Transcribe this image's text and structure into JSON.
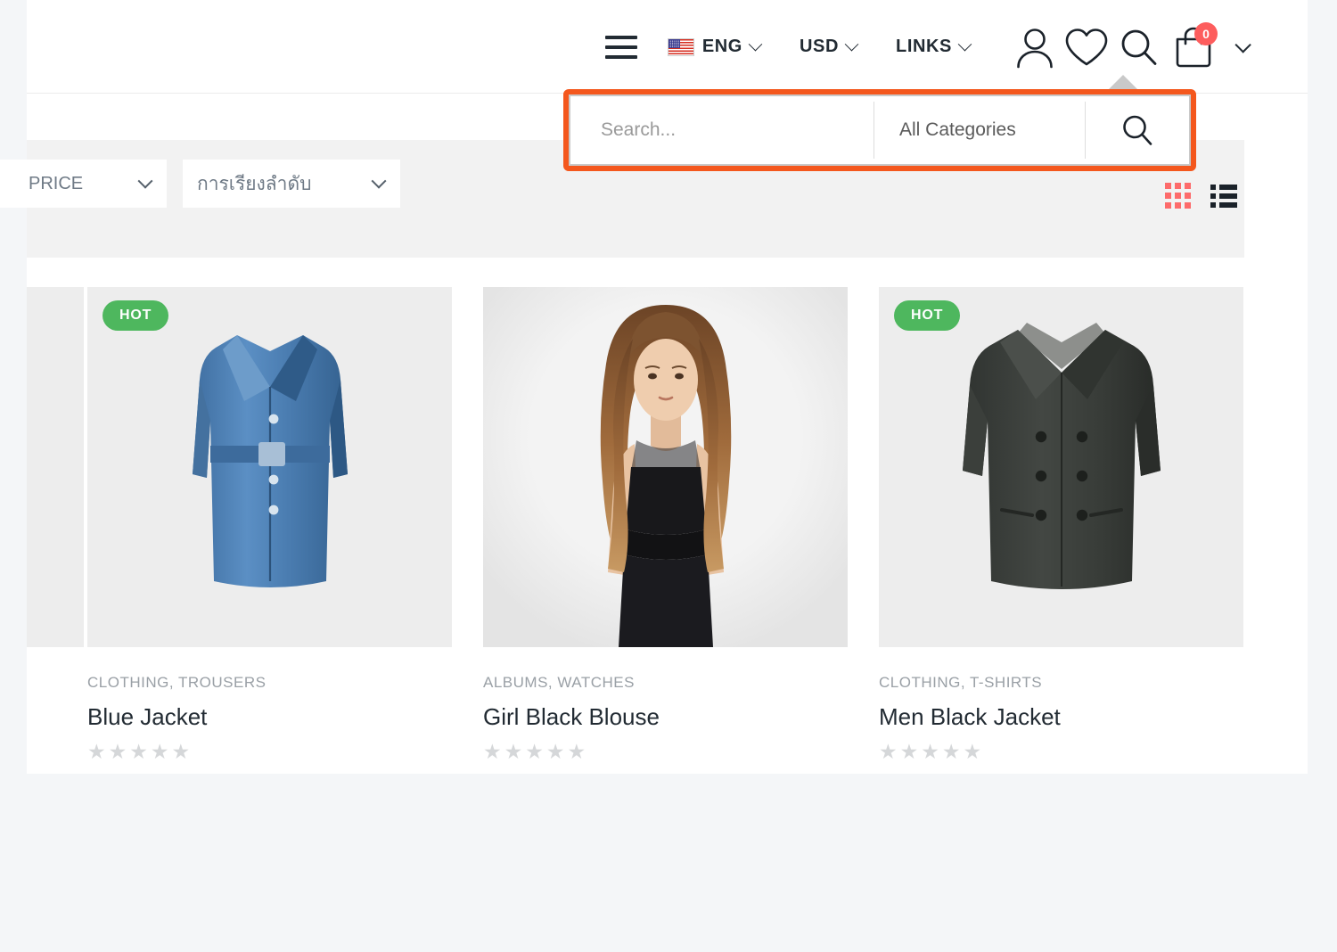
{
  "header": {
    "menu_icon": "hamburger-icon",
    "language": {
      "label": "ENG",
      "flag": "us-flag-icon"
    },
    "currency": {
      "label": "USD"
    },
    "links": {
      "label": "LINKS"
    },
    "account_icon": "user-icon",
    "wishlist_icon": "heart-icon",
    "search_icon": "search-icon",
    "cart_icon": "shopping-bag-icon",
    "cart_count": "0"
  },
  "search_panel": {
    "input_value": "",
    "placeholder": "Search...",
    "category_selected": "All Categories",
    "submit_icon": "search-icon",
    "highlight_color": "#f4571d"
  },
  "toolbar": {
    "price_filter": "PRICE",
    "sort_filter": "การเรียงลำดับ",
    "grid_view_icon": "grid-view-icon",
    "list_view_icon": "list-view-icon",
    "grid_view_color": "#fd6b6b",
    "list_view_color": "#1b222a"
  },
  "products": [
    {
      "badge": "HOT",
      "category": "CLOTHING, TROUSERS",
      "title": "Blue Jacket",
      "rating": 0,
      "stars_total": 5,
      "image": "blue-coat-product-image"
    },
    {
      "badge": "",
      "category": "ALBUMS, WATCHES",
      "title": "Girl Black Blouse",
      "rating": 0,
      "stars_total": 5,
      "image": "girl-black-blouse-product-image"
    },
    {
      "badge": "HOT",
      "category": "CLOTHING, T-SHIRTS",
      "title": "Men Black Jacket",
      "rating": 0,
      "stars_total": 5,
      "image": "men-black-jacket-product-image"
    }
  ],
  "colors": {
    "badge_green": "#4eb75e",
    "accent_red": "#fd5d5d",
    "page_bg": "#f4f6f8",
    "toolbar_bg": "#f2f2f2",
    "thumb_bg": "#ededed"
  }
}
